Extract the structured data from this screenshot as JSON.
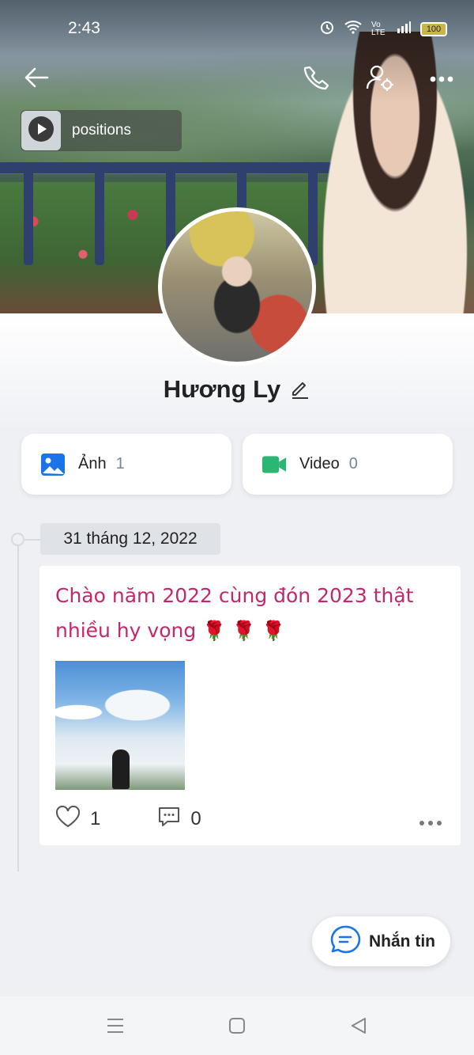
{
  "status_bar": {
    "time": "2:43",
    "network": "Vo LTE",
    "battery": "100"
  },
  "cover": {
    "music_title": "positions"
  },
  "profile": {
    "name": "Hương Ly"
  },
  "media": {
    "photos_label": "Ảnh",
    "photos_count": "1",
    "videos_label": "Video",
    "videos_count": "0",
    "photos_color": "#1a73e8",
    "videos_color": "#2bb673"
  },
  "timeline": {
    "date": "31 tháng 12, 2022",
    "post": {
      "text": "Chào năm 2022 cùng đón 2023 thật nhiều hy vọng",
      "roses": "🌹 🌹 🌹",
      "likes": "1",
      "comments": "0",
      "text_color": "#c2286b"
    }
  },
  "message_button": {
    "label": "Nhắn tin"
  },
  "icons": [
    "back-arrow-icon",
    "phone-icon",
    "user-settings-icon",
    "more-icon",
    "play-icon",
    "image-icon",
    "video-camera-icon",
    "edit-pencil-icon",
    "heart-icon",
    "comment-icon",
    "chat-bubble-icon",
    "menu-icon",
    "home-square-icon",
    "back-triangle-icon"
  ]
}
